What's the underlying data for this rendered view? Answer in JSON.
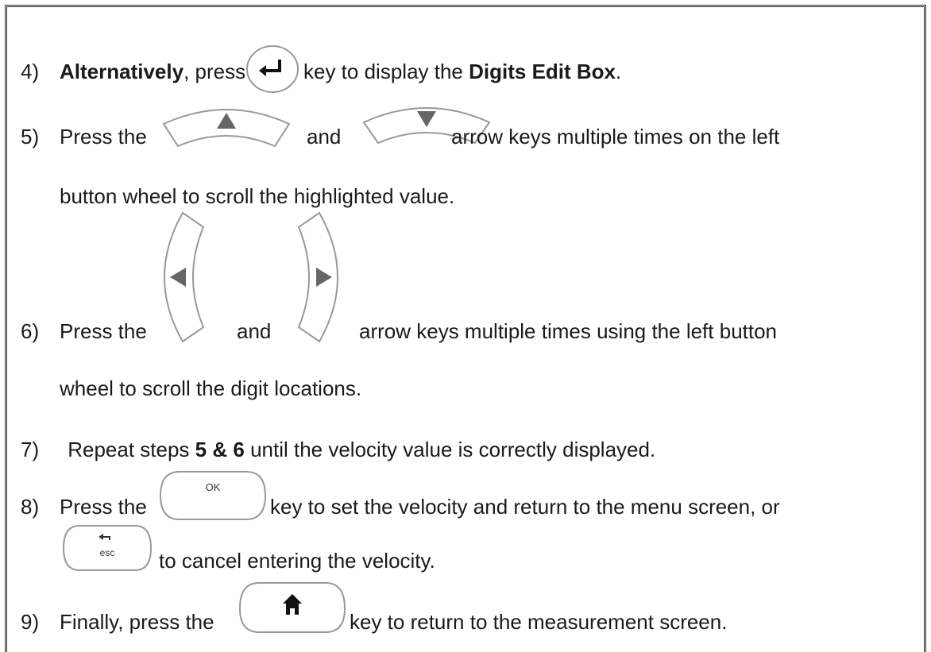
{
  "steps": {
    "s4": {
      "num": "4)",
      "bold1": "Alternatively",
      "t1": ", press the",
      "t2": "key to display the",
      "bold2": "Digits Edit Box",
      "t3": "."
    },
    "s5": {
      "num": "5)",
      "t1": "Press the",
      "and": "and",
      "t2": "arrow keys multiple times on the left",
      "line2": "button wheel to scroll the highlighted value."
    },
    "s6": {
      "num": "6)",
      "t1": "Press the",
      "and": "and",
      "t2": "arrow keys multiple times using the left button",
      "line2": "wheel to scroll the digit locations."
    },
    "s7": {
      "num": "7)",
      "t1": " Repeat steps",
      "bold": "5 & 6",
      "t2": "until the velocity value is correctly displayed."
    },
    "s8": {
      "num": "8)",
      "t1": "Press the",
      "t2": "key to set the velocity and return to the menu screen, or",
      "line2": "to cancel entering the velocity."
    },
    "s9": {
      "num": "9)",
      "t1": "Finally, press the",
      "t2": "key to return to the measurement screen."
    }
  },
  "keys": {
    "ok_label": "OK",
    "esc_label": "esc"
  }
}
